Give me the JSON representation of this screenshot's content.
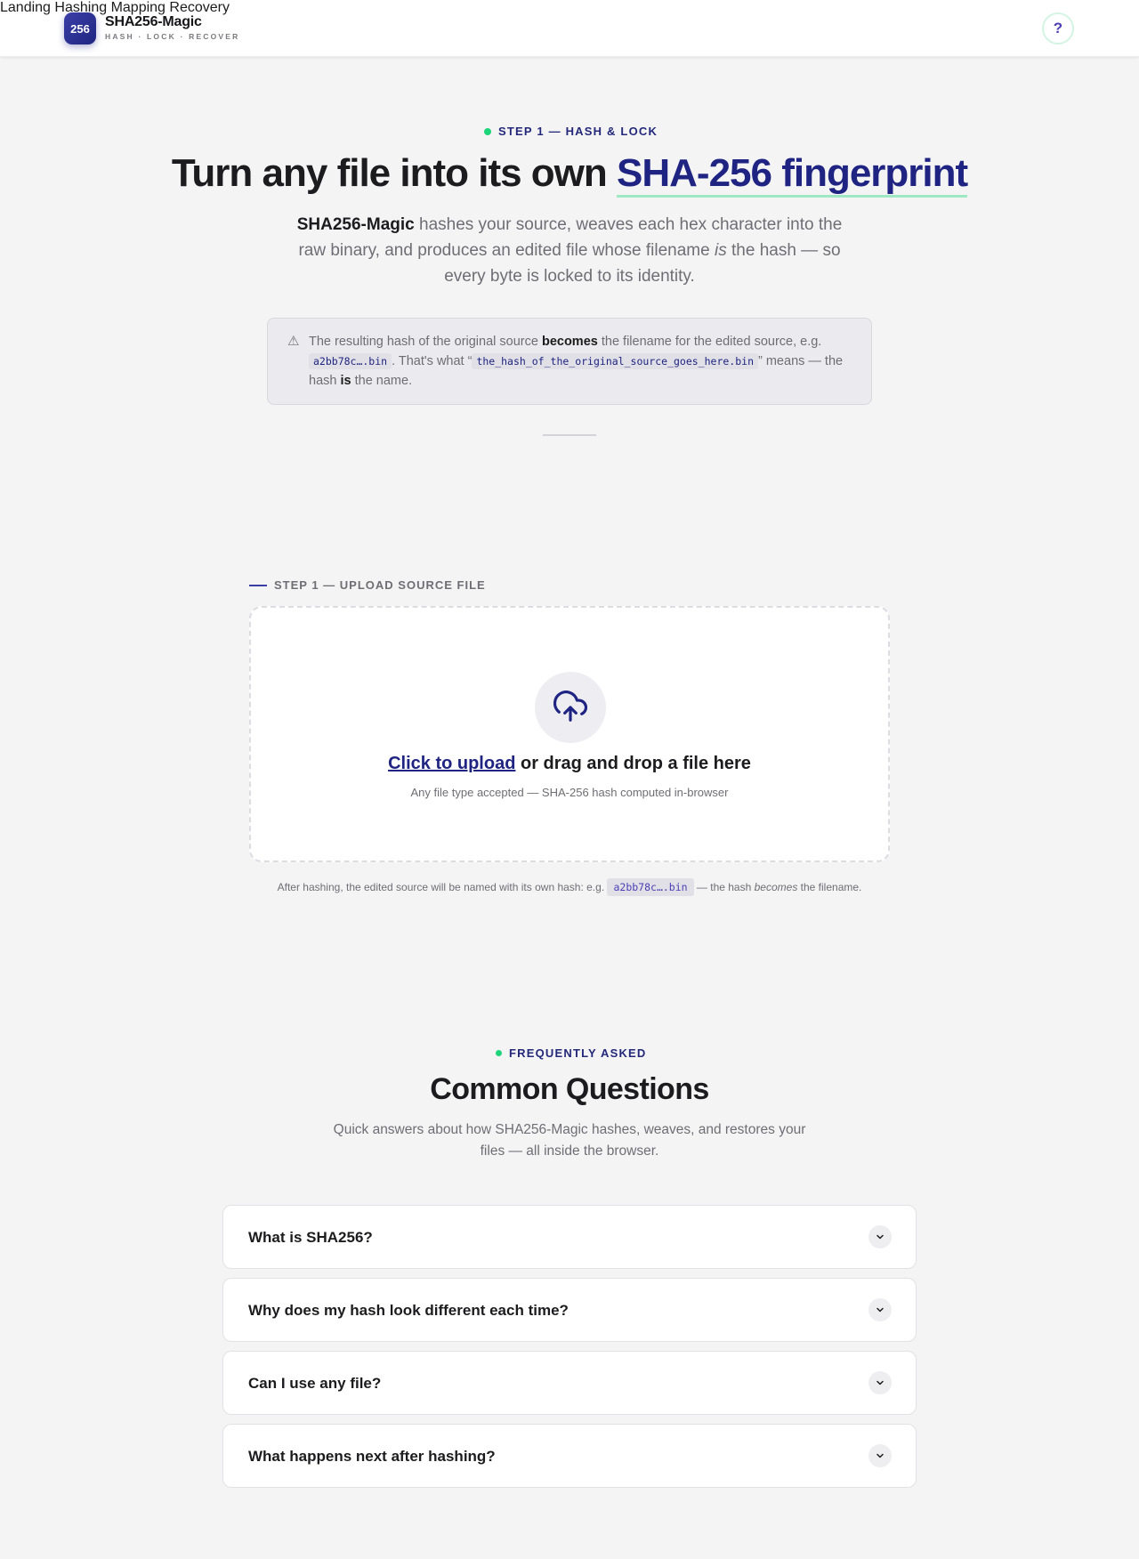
{
  "header": {
    "logo_text": "256",
    "brand_name": "SHA256-Magic",
    "brand_tagline": "HASH · LOCK · RECOVER",
    "nav": [
      {
        "label": "Landing"
      },
      {
        "label": "Hashing"
      },
      {
        "label": "Mapping"
      },
      {
        "label": "Recovery"
      }
    ],
    "help_label": "?"
  },
  "hero": {
    "eyebrow": "STEP 1 — HASH & LOCK",
    "title_prefix": "Turn any file into its own",
    "title_highlight": "SHA-256 fingerprint",
    "sub_brand": "SHA256-Magic",
    "sub_part1": " hashes your source, weaves each hex character into the raw binary, and produces an edited file whose filename ",
    "sub_em": "is",
    "sub_part2": " the hash — so every byte is locked to its identity.",
    "notice": {
      "icon": "warning-icon",
      "part1": "The resulting hash of the original source ",
      "bold1": "becomes",
      "part2": " the filename for the edited source, e.g. ",
      "code1": "a2bb78c….bin",
      "part3": ". That's what “",
      "code2": "the_hash_of_the_original_source_goes_here.bin",
      "part4": "” means — the hash ",
      "bold2": "is",
      "part5": " the name."
    }
  },
  "upload": {
    "label": "STEP 1 — UPLOAD SOURCE FILE",
    "icon": "cloud-upload-icon",
    "link_text": "Click to upload",
    "main_rest": " or drag and drop a file here",
    "hint": "Any file type accepted — SHA-256 hash computed in-browser",
    "after_part1": "After hashing, the edited source will be named with its own hash: e.g. ",
    "after_code": "a2bb78c….bin",
    "after_part2": " — the hash ",
    "after_em": "becomes",
    "after_part3": " the filename."
  },
  "faq": {
    "eyebrow": "FREQUENTLY ASKED",
    "title": "Common Questions",
    "subtitle": "Quick answers about how SHA256-Magic hashes, weaves, and restores your files — all inside the browser.",
    "items": [
      {
        "question": "What is SHA256?"
      },
      {
        "question": "Why does my hash look different each time?"
      },
      {
        "question": "Can I use any file?"
      },
      {
        "question": "What happens next after hashing?"
      }
    ]
  },
  "colors": {
    "accent": "#1f2482",
    "green": "#1ed47a",
    "background": "#f4f4f5"
  }
}
